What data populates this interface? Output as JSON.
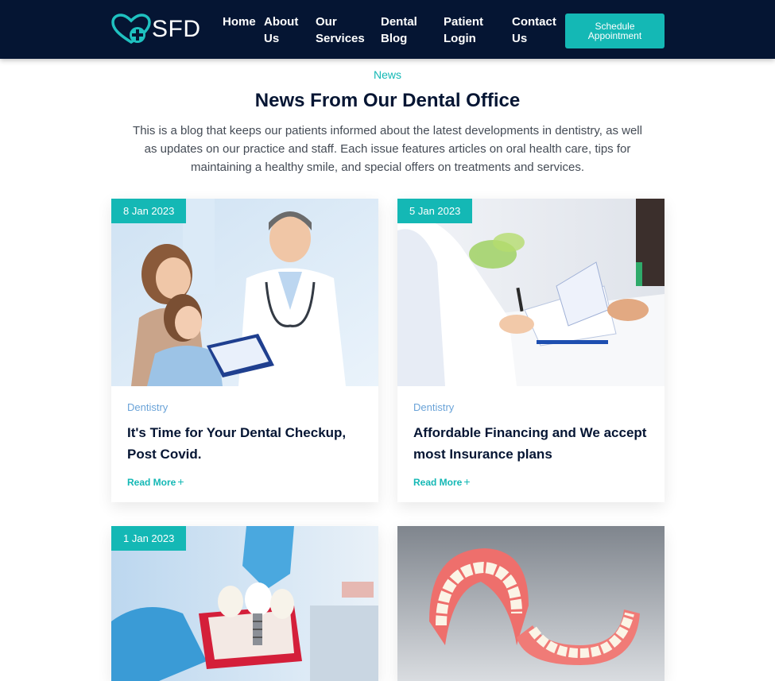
{
  "brand": {
    "name": "SFD",
    "accent": "#14b8b5",
    "navy": "#051533"
  },
  "nav": {
    "items": [
      {
        "line1": "Home",
        "line2": ""
      },
      {
        "line1": "About",
        "line2": "Us"
      },
      {
        "line1": "Our",
        "line2": "Services"
      },
      {
        "line1": "Dental",
        "line2": "Blog"
      },
      {
        "line1": "Patient",
        "line2": "Login"
      },
      {
        "line1": "Contact",
        "line2": "Us"
      }
    ],
    "cta": {
      "line1": "Schedule",
      "line2": "Appointment"
    }
  },
  "intro": {
    "eyebrow": "News",
    "title": "News From Our Dental Office",
    "text": "This is a blog that keeps our patients informed about the latest developments in dentistry, as well as updates on our practice and staff. Each issue features articles on oral health care, tips for maintaining a healthy smile, and special offers on treatments and services."
  },
  "posts": [
    {
      "date": "8 Jan 2023",
      "category": "Dentistry",
      "title": "It's Time for Your Dental Checkup, Post Covid.",
      "read_more": "Read More",
      "image": "doctor-family-photo"
    },
    {
      "date": "5 Jan 2023",
      "category": "Dentistry",
      "title": "Affordable Financing and We accept most Insurance plans",
      "read_more": "Read More",
      "image": "consultation-paperwork-photo"
    },
    {
      "date": "1 Jan 2023",
      "image": "dental-implant-model-photo"
    },
    {
      "image": "dentures-photo"
    }
  ]
}
